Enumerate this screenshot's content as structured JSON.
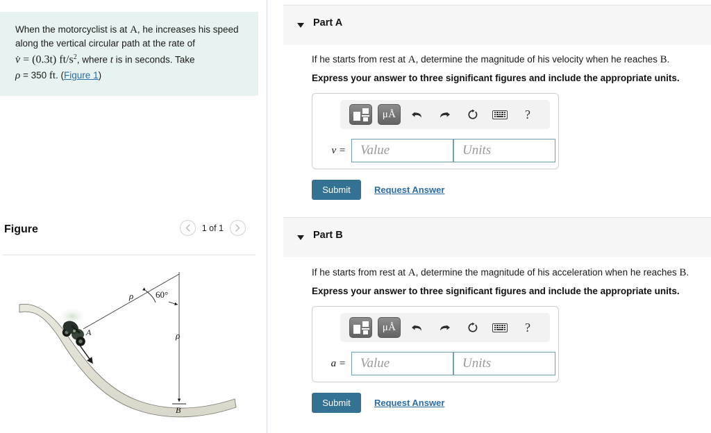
{
  "problem": {
    "line1": "When the motorcyclist is at ",
    "pointA": "A",
    "line1b": ", he increases his speed",
    "line2": "along the vertical circular path at the rate of",
    "eq_v": "v̇",
    "eq_equals": " = ",
    "eq_rate": "(0.3t)",
    "eq_units": "ft/s",
    "eq_exp": "2",
    "line3b": ", where ",
    "eq_t": "t",
    "line3c": " is in seconds. Take",
    "eq_rho": "ρ",
    "eq_rho_val": " = 350 ",
    "eq_ft": "ft",
    "eq_dot": ". (",
    "figure_link": "Figure 1",
    "close_paren": ")"
  },
  "figure": {
    "title": "Figure",
    "counter": "1 of 1",
    "prev_icon": "chevron-left-icon",
    "next_icon": "chevron-right-icon",
    "labels": {
      "point_a": "A",
      "point_b": "B",
      "rho_upper": "ρ",
      "rho_lower": "ρ",
      "angle": "60°"
    }
  },
  "toolbar": {
    "template_icon": "math-template-icon",
    "units_icon": "μÅ",
    "undo_icon": "undo-arrow-icon",
    "redo_icon": "redo-arrow-icon",
    "reset_icon": "reset-circular-arrow-icon",
    "keyboard_icon": "keyboard-icon",
    "help_icon": "?"
  },
  "parts": [
    {
      "label": "Part A",
      "question_pre": "If he starts from rest at ",
      "question_a": "A",
      "question_mid": ", determine the magnitude of his velocity when he reaches ",
      "question_b": "B",
      "question_end": ".",
      "instruction": "Express your answer to three significant figures and include the appropriate units.",
      "eq_label": "v =",
      "value_placeholder": "Value",
      "units_placeholder": "Units",
      "value_text": "",
      "units_text": "",
      "submit_label": "Submit",
      "request_label": "Request Answer"
    },
    {
      "label": "Part B",
      "question_pre": "If he starts from rest at ",
      "question_a": "A",
      "question_mid": ", determine the magnitude of his acceleration when he reaches ",
      "question_b": "B",
      "question_end": ".",
      "instruction": "Express your answer to three significant figures and include the appropriate units.",
      "eq_label": "a =",
      "value_placeholder": "Value",
      "units_placeholder": "Units",
      "value_text": "",
      "units_text": "",
      "submit_label": "Submit",
      "request_label": "Request Answer"
    }
  ],
  "colors": {
    "problem_bg": "#e7f3f1",
    "submit_bg": "#337293",
    "link": "#2b6ca3",
    "band_bg": "#f7f7f7",
    "input_border": "#6f9fb8"
  }
}
